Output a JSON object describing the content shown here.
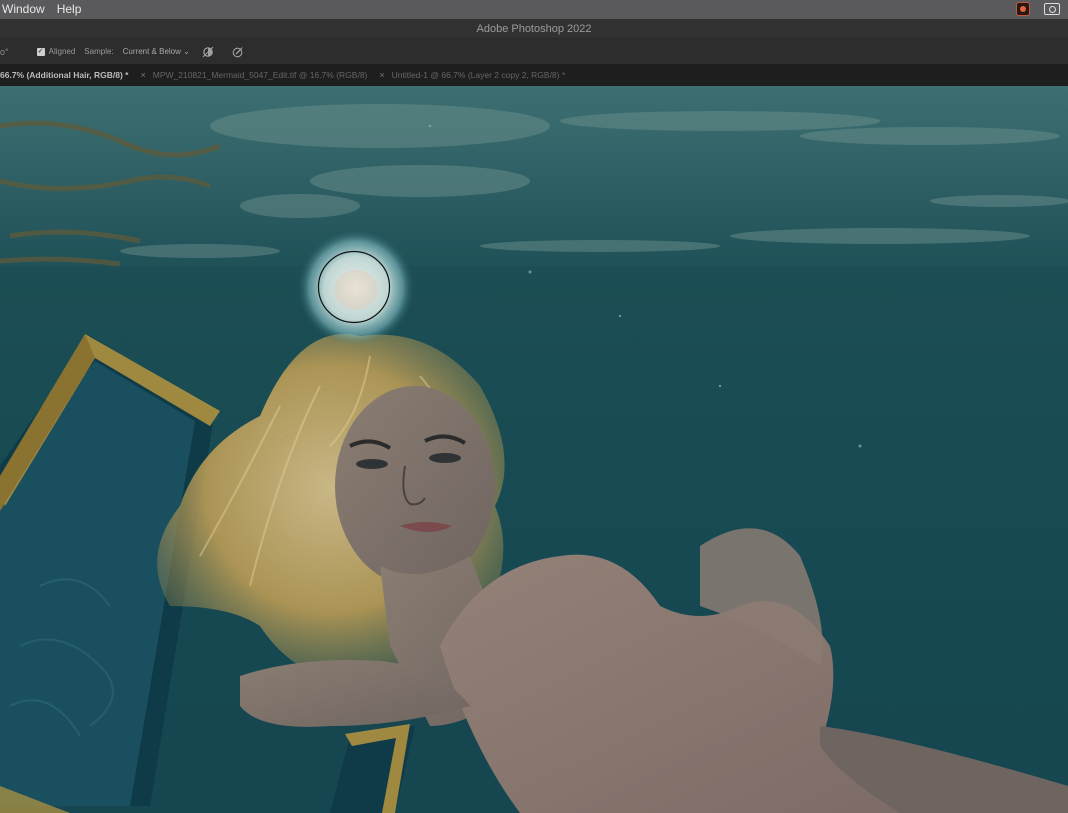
{
  "menubar": {
    "items": [
      "Window",
      "Help"
    ]
  },
  "window": {
    "title": "Adobe Photoshop 2022"
  },
  "options_bar": {
    "leading_fragment": "o°",
    "aligned_label": "Aligned",
    "aligned_checked": true,
    "sample_label": "Sample:",
    "sample_value": "Current & Below",
    "sample_arrow": "⌄"
  },
  "tabs": [
    {
      "label": "66.7% (Additional Hair, RGB/8) *",
      "active": true
    },
    {
      "close": "×",
      "label": "MPW_210821_Mermaid_5047_Edit.tif @ 16.7% (RGB/8)",
      "active": false
    },
    {
      "close": "×",
      "label": "Untitled-1 @ 66.7% (Layer 2 copy 2, RGB/8) *",
      "active": false
    }
  ],
  "icons": {
    "ignore_adjustments": "ignore-adjustment-layers-icon",
    "pressure": "pressure-size-icon",
    "app_status": "photoshop-status-icon",
    "screen_share": "screen-sharing-icon"
  },
  "colors": {
    "water": "#1d4e55",
    "hair": "#c9ad6a",
    "frame_gold": "#b8973f",
    "brush_glow": "#e6f3f0"
  }
}
